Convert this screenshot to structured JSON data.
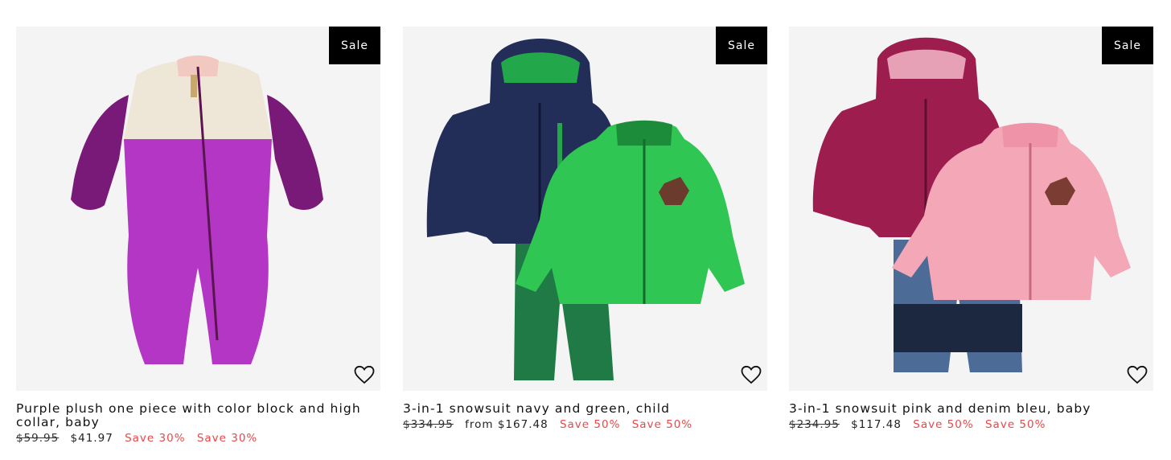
{
  "accent": {
    "sale_badge_bg": "#000000",
    "save_text": "#e8484a"
  },
  "products": [
    {
      "badge": "Sale",
      "title": "Purple plush one piece with color block and high collar, baby",
      "old_price": "$59.95",
      "price": "$41.97",
      "save_1": "Save 30%",
      "save_2": "Save 30%",
      "wishlist_icon": "heart-outline-icon"
    },
    {
      "badge": "Sale",
      "title": "3-in-1 snowsuit navy and green, child",
      "old_price": "$334.95",
      "price": "from $167.48",
      "save_1": "Save 50%",
      "save_2": "Save 50%",
      "wishlist_icon": "heart-outline-icon"
    },
    {
      "badge": "Sale",
      "title": "3-in-1 snowsuit pink and denim bleu, baby",
      "old_price": "$234.95",
      "price": "$117.48",
      "save_1": "Save 50%",
      "save_2": "Save 50%",
      "wishlist_icon": "heart-outline-icon"
    }
  ]
}
